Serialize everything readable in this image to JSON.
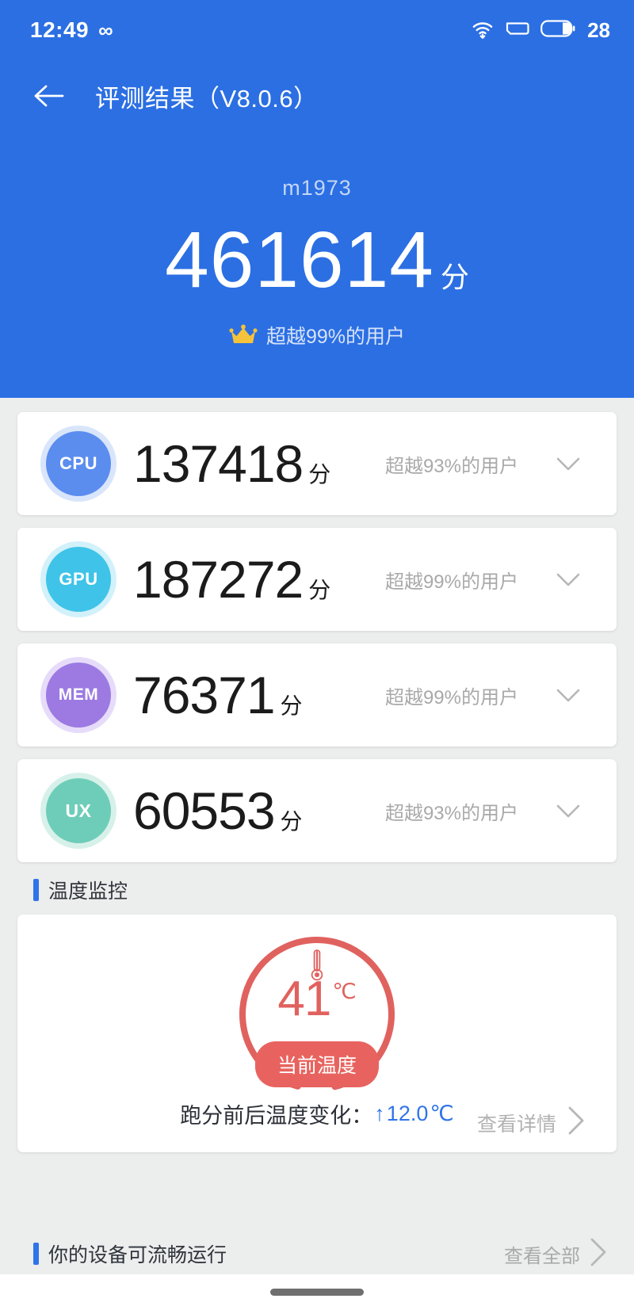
{
  "status_bar": {
    "time": "12:49",
    "infinity_icon": "infinity-icon",
    "wifi_icon": "wifi-icon",
    "signal_icon": "signal-icon",
    "battery_icon": "battery-icon",
    "battery_level": "28"
  },
  "app_bar": {
    "back_icon": "back-arrow-icon",
    "title": "评测结果（V8.0.6）"
  },
  "hero": {
    "device_name": "m1973",
    "total_score": "461614",
    "score_unit": "分",
    "crown_icon": "crown-icon",
    "rank_text": "超越99%的用户",
    "background_color": "#2b6fe3"
  },
  "metrics": [
    {
      "key": "cpu",
      "badge_label": "CPU",
      "score": "137418",
      "unit": "分",
      "rank_text": "超越93%的用户",
      "color": "#5b8def",
      "ring_color": "#d9e5fb",
      "chevron_icon": "chevron-down-icon"
    },
    {
      "key": "gpu",
      "badge_label": "GPU",
      "score": "187272",
      "unit": "分",
      "rank_text": "超越99%的用户",
      "color": "#3fc3e8",
      "ring_color": "#d2f1fa",
      "chevron_icon": "chevron-down-icon"
    },
    {
      "key": "mem",
      "badge_label": "MEM",
      "score": "76371",
      "unit": "分",
      "rank_text": "超越99%的用户",
      "color": "#9c7ae2",
      "ring_color": "#e6dcfa",
      "chevron_icon": "chevron-down-icon"
    },
    {
      "key": "ux",
      "badge_label": "UX",
      "score": "60553",
      "unit": "分",
      "rank_text": "超越93%的用户",
      "color": "#6ecdb8",
      "ring_color": "#d7f1ea",
      "chevron_icon": "chevron-down-icon"
    }
  ],
  "temperature_section": {
    "header_title": "温度监控",
    "thermometer_icon": "thermometer-icon",
    "current_value": "41",
    "current_unit": "℃",
    "pill_label": "当前温度",
    "delta_label": "跑分前后温度变化：",
    "delta_arrow": "↑",
    "delta_value": "12.0",
    "delta_unit": "℃",
    "detail_link": "查看详情",
    "detail_chevron_icon": "chevron-right-icon",
    "gauge_color": "#e0625f",
    "gauge_track_color": "#efefef",
    "gauge_percent": 92
  },
  "bottom_section": {
    "title": "你的设备可流畅运行",
    "view_all": "查看全部",
    "chevron_icon": "chevron-right-icon"
  },
  "nav_bar": {
    "home_indicator": "home-indicator"
  }
}
